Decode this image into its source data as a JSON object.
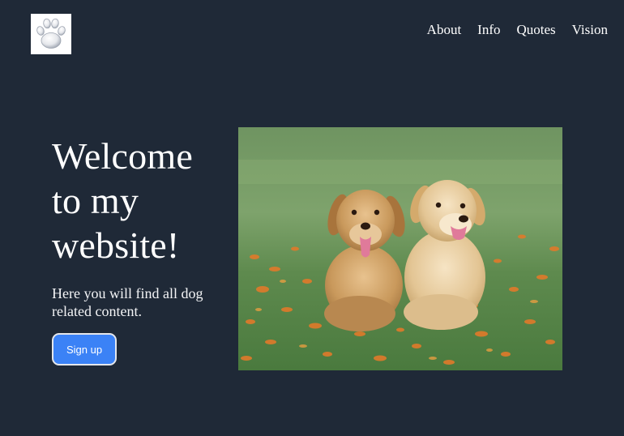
{
  "header": {
    "logo_icon": "paw-print-icon",
    "nav": [
      {
        "label": "About"
      },
      {
        "label": "Info"
      },
      {
        "label": "Quotes"
      },
      {
        "label": "Vision"
      }
    ]
  },
  "hero": {
    "title": "Welcome to my website!",
    "subtitle": "Here you will find all dog related content.",
    "signup_label": "Sign up",
    "image_icon": "puppies-photo"
  },
  "colors": {
    "background": "#1f2937",
    "button": "#3b82f6",
    "text": "#ffffff"
  }
}
